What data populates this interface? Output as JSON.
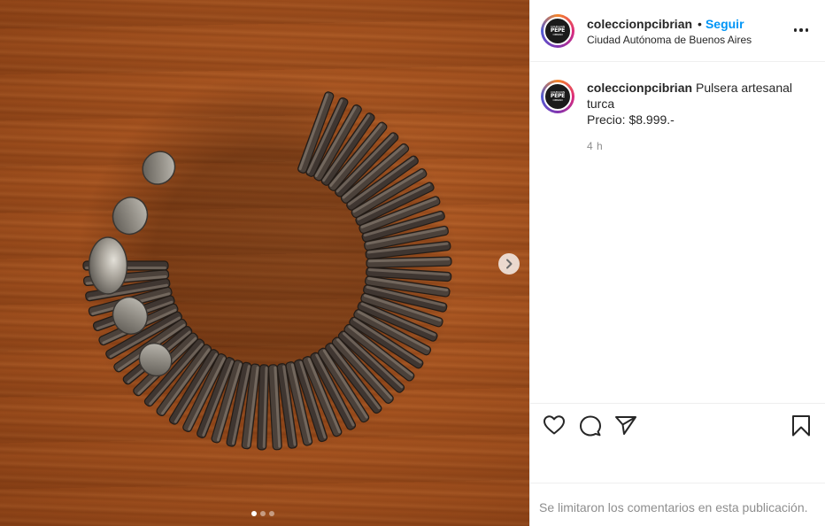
{
  "post": {
    "media": {
      "description_icon": "bracelet-photo",
      "carousel": {
        "total": 3,
        "active_index": 0
      }
    },
    "header": {
      "username": "coleccionpcibrian",
      "separator": "•",
      "follow_label": "Seguir",
      "location": "Ciudad Autónoma de Buenos Aires",
      "avatar": {
        "line1": "COLECCION",
        "line2": "PEPE",
        "line3": "CIBRIAN"
      },
      "more_icon": "more-horizontal-icon"
    },
    "caption": {
      "username": "coleccionpcibrian",
      "text": "Pulsera artesanal turca",
      "price": "Precio: $8.999.-",
      "timestamp": "4 h"
    },
    "actions": {
      "like_icon": "heart-icon",
      "comment_icon": "comment-icon",
      "share_icon": "paper-plane-icon",
      "save_icon": "bookmark-icon"
    },
    "comments_limited_text": "Se limitaron los comentarios en esta publicación."
  }
}
